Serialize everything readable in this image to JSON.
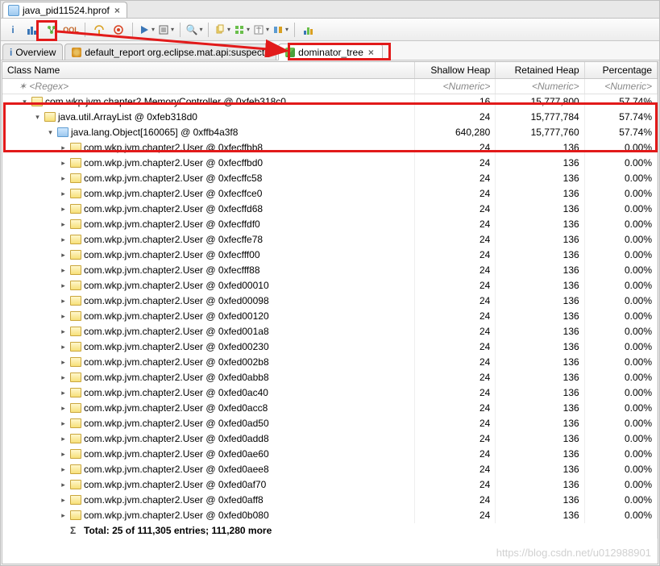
{
  "file_tab": {
    "label": "java_pid11524.hprof",
    "close": "×"
  },
  "toolbar": {
    "info": "i",
    "search": "🔍"
  },
  "subtabs": {
    "overview": {
      "icon_label": "i",
      "label": "Overview"
    },
    "report": {
      "label": "default_report  org.eclipse.mat.api:suspects"
    },
    "domtree": {
      "label": "dominator_tree",
      "close": "×"
    }
  },
  "columns": {
    "name": "Class Name",
    "shallow": "Shallow Heap",
    "retained": "Retained Heap",
    "pct": "Percentage"
  },
  "filters": {
    "name": "<Regex>",
    "shallow": "<Numeric>",
    "retained": "<Numeric>",
    "pct": "<Numeric>"
  },
  "rows": [
    {
      "indent": 1,
      "expander": "▾",
      "icon": "class",
      "label": "com.wkp.jvm.chapter2.MemoryController @ 0xfeb318c0",
      "shallow": "16",
      "retained": "15,777,800",
      "pct": "57.74%"
    },
    {
      "indent": 2,
      "expander": "▾",
      "icon": "class",
      "label": "java.util.ArrayList @ 0xfeb318d0",
      "shallow": "24",
      "retained": "15,777,784",
      "pct": "57.74%"
    },
    {
      "indent": 3,
      "expander": "▾",
      "icon": "obj",
      "label": "java.lang.Object[160065] @ 0xffb4a3f8",
      "shallow": "640,280",
      "retained": "15,777,760",
      "pct": "57.74%"
    },
    {
      "indent": 4,
      "expander": "▸",
      "icon": "class",
      "label": "com.wkp.jvm.chapter2.User @ 0xfecffbb8",
      "shallow": "24",
      "retained": "136",
      "pct": "0.00%"
    },
    {
      "indent": 4,
      "expander": "▸",
      "icon": "class",
      "label": "com.wkp.jvm.chapter2.User @ 0xfecffbd0",
      "shallow": "24",
      "retained": "136",
      "pct": "0.00%"
    },
    {
      "indent": 4,
      "expander": "▸",
      "icon": "class",
      "label": "com.wkp.jvm.chapter2.User @ 0xfecffc58",
      "shallow": "24",
      "retained": "136",
      "pct": "0.00%"
    },
    {
      "indent": 4,
      "expander": "▸",
      "icon": "class",
      "label": "com.wkp.jvm.chapter2.User @ 0xfecffce0",
      "shallow": "24",
      "retained": "136",
      "pct": "0.00%"
    },
    {
      "indent": 4,
      "expander": "▸",
      "icon": "class",
      "label": "com.wkp.jvm.chapter2.User @ 0xfecffd68",
      "shallow": "24",
      "retained": "136",
      "pct": "0.00%"
    },
    {
      "indent": 4,
      "expander": "▸",
      "icon": "class",
      "label": "com.wkp.jvm.chapter2.User @ 0xfecffdf0",
      "shallow": "24",
      "retained": "136",
      "pct": "0.00%"
    },
    {
      "indent": 4,
      "expander": "▸",
      "icon": "class",
      "label": "com.wkp.jvm.chapter2.User @ 0xfecffe78",
      "shallow": "24",
      "retained": "136",
      "pct": "0.00%"
    },
    {
      "indent": 4,
      "expander": "▸",
      "icon": "class",
      "label": "com.wkp.jvm.chapter2.User @ 0xfecfff00",
      "shallow": "24",
      "retained": "136",
      "pct": "0.00%"
    },
    {
      "indent": 4,
      "expander": "▸",
      "icon": "class",
      "label": "com.wkp.jvm.chapter2.User @ 0xfecfff88",
      "shallow": "24",
      "retained": "136",
      "pct": "0.00%"
    },
    {
      "indent": 4,
      "expander": "▸",
      "icon": "class",
      "label": "com.wkp.jvm.chapter2.User @ 0xfed00010",
      "shallow": "24",
      "retained": "136",
      "pct": "0.00%"
    },
    {
      "indent": 4,
      "expander": "▸",
      "icon": "class",
      "label": "com.wkp.jvm.chapter2.User @ 0xfed00098",
      "shallow": "24",
      "retained": "136",
      "pct": "0.00%"
    },
    {
      "indent": 4,
      "expander": "▸",
      "icon": "class",
      "label": "com.wkp.jvm.chapter2.User @ 0xfed00120",
      "shallow": "24",
      "retained": "136",
      "pct": "0.00%"
    },
    {
      "indent": 4,
      "expander": "▸",
      "icon": "class",
      "label": "com.wkp.jvm.chapter2.User @ 0xfed001a8",
      "shallow": "24",
      "retained": "136",
      "pct": "0.00%"
    },
    {
      "indent": 4,
      "expander": "▸",
      "icon": "class",
      "label": "com.wkp.jvm.chapter2.User @ 0xfed00230",
      "shallow": "24",
      "retained": "136",
      "pct": "0.00%"
    },
    {
      "indent": 4,
      "expander": "▸",
      "icon": "class",
      "label": "com.wkp.jvm.chapter2.User @ 0xfed002b8",
      "shallow": "24",
      "retained": "136",
      "pct": "0.00%"
    },
    {
      "indent": 4,
      "expander": "▸",
      "icon": "class",
      "label": "com.wkp.jvm.chapter2.User @ 0xfed0abb8",
      "shallow": "24",
      "retained": "136",
      "pct": "0.00%"
    },
    {
      "indent": 4,
      "expander": "▸",
      "icon": "class",
      "label": "com.wkp.jvm.chapter2.User @ 0xfed0ac40",
      "shallow": "24",
      "retained": "136",
      "pct": "0.00%"
    },
    {
      "indent": 4,
      "expander": "▸",
      "icon": "class",
      "label": "com.wkp.jvm.chapter2.User @ 0xfed0acc8",
      "shallow": "24",
      "retained": "136",
      "pct": "0.00%"
    },
    {
      "indent": 4,
      "expander": "▸",
      "icon": "class",
      "label": "com.wkp.jvm.chapter2.User @ 0xfed0ad50",
      "shallow": "24",
      "retained": "136",
      "pct": "0.00%"
    },
    {
      "indent": 4,
      "expander": "▸",
      "icon": "class",
      "label": "com.wkp.jvm.chapter2.User @ 0xfed0add8",
      "shallow": "24",
      "retained": "136",
      "pct": "0.00%"
    },
    {
      "indent": 4,
      "expander": "▸",
      "icon": "class",
      "label": "com.wkp.jvm.chapter2.User @ 0xfed0ae60",
      "shallow": "24",
      "retained": "136",
      "pct": "0.00%"
    },
    {
      "indent": 4,
      "expander": "▸",
      "icon": "class",
      "label": "com.wkp.jvm.chapter2.User @ 0xfed0aee8",
      "shallow": "24",
      "retained": "136",
      "pct": "0.00%"
    },
    {
      "indent": 4,
      "expander": "▸",
      "icon": "class",
      "label": "com.wkp.jvm.chapter2.User @ 0xfed0af70",
      "shallow": "24",
      "retained": "136",
      "pct": "0.00%"
    },
    {
      "indent": 4,
      "expander": "▸",
      "icon": "class",
      "label": "com.wkp.jvm.chapter2.User @ 0xfed0aff8",
      "shallow": "24",
      "retained": "136",
      "pct": "0.00%"
    },
    {
      "indent": 4,
      "expander": "▸",
      "icon": "class",
      "label": "com.wkp.jvm.chapter2.User @ 0xfed0b080",
      "shallow": "24",
      "retained": "136",
      "pct": "0.00%"
    }
  ],
  "total_row": {
    "label": "Total: 25 of 111,305 entries; 111,280 more"
  },
  "watermark": "https://blog.csdn.net/u012988901"
}
